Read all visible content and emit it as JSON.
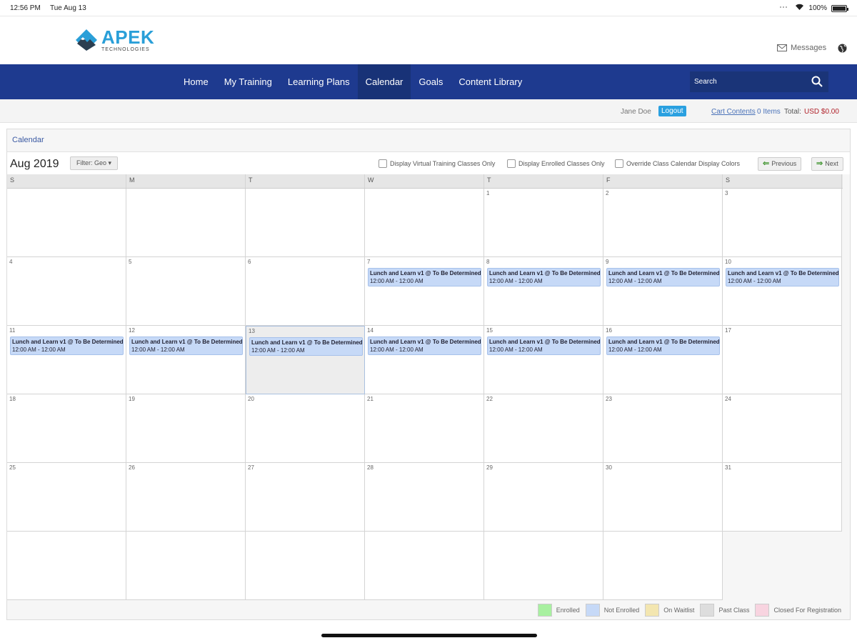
{
  "status_bar": {
    "time": "12:56 PM",
    "date": "Tue Aug 13",
    "battery": "100%",
    "battery_level": 1.0
  },
  "brand": {
    "name": "APEK",
    "subtitle": "TECHNOLOGIES",
    "color": "#2a9fd8"
  },
  "header": {
    "messages_label": "Messages"
  },
  "nav": {
    "items": [
      "Home",
      "My Training",
      "Learning Plans",
      "Calendar",
      "Goals",
      "Content Library"
    ],
    "active": "Calendar",
    "search_placeholder": "Search",
    "bg_color": "#1e3a8f"
  },
  "user": {
    "name": "Jane Doe",
    "logout_label": "Logout",
    "cart_link": "Cart Contents",
    "cart_items": "0 Items",
    "total_label": "Total:",
    "total_value": "USD $0.00"
  },
  "calendar": {
    "panel_title": "Calendar",
    "month_label": "Aug 2019",
    "filter_label": "Filter: Geo",
    "options": [
      "Display Virtual Training Classes Only",
      "Display Enrolled Classes Only",
      "Override Class Calendar Display Colors"
    ],
    "previous_label": "Previous",
    "next_label": "Next",
    "days_of_week": [
      "S",
      "M",
      "T",
      "W",
      "T",
      "F",
      "S"
    ],
    "event_title": "Lunch and Learn v1 @ To Be Determined",
    "event_time": "12:00 AM - 12:00 AM",
    "today": "13",
    "weeks": [
      [
        {
          "day": ""
        },
        {
          "day": ""
        },
        {
          "day": ""
        },
        {
          "day": ""
        },
        {
          "day": "1"
        },
        {
          "day": "2"
        },
        {
          "day": "3"
        }
      ],
      [
        {
          "day": "4"
        },
        {
          "day": "5"
        },
        {
          "day": "6"
        },
        {
          "day": "7",
          "event": true
        },
        {
          "day": "8",
          "event": true
        },
        {
          "day": "9",
          "event": true
        },
        {
          "day": "10",
          "event": true
        }
      ],
      [
        {
          "day": "11",
          "event": true
        },
        {
          "day": "12",
          "event": true
        },
        {
          "day": "13",
          "event": true
        },
        {
          "day": "14",
          "event": true
        },
        {
          "day": "15",
          "event": true
        },
        {
          "day": "16",
          "event": true
        },
        {
          "day": "17"
        }
      ],
      [
        {
          "day": "18"
        },
        {
          "day": "19"
        },
        {
          "day": "20"
        },
        {
          "day": "21"
        },
        {
          "day": "22"
        },
        {
          "day": "23"
        },
        {
          "day": "24"
        }
      ],
      [
        {
          "day": "25"
        },
        {
          "day": "26"
        },
        {
          "day": "27"
        },
        {
          "day": "28"
        },
        {
          "day": "29"
        },
        {
          "day": "30"
        },
        {
          "day": "31"
        }
      ],
      [
        {
          "day": ""
        },
        {
          "day": ""
        },
        {
          "day": ""
        },
        {
          "day": ""
        },
        {
          "day": ""
        },
        {
          "day": ""
        },
        {
          "day": "",
          "blank": true
        }
      ]
    ]
  },
  "legend": [
    {
      "label": "Enrolled",
      "color": "#a8f0a0"
    },
    {
      "label": "Not Enrolled",
      "color": "#c6d9f7"
    },
    {
      "label": "On Waitlist",
      "color": "#f3e6b0"
    },
    {
      "label": "Past Class",
      "color": "#dddddd"
    },
    {
      "label": "Closed For Registration",
      "color": "#f8d4e0"
    }
  ]
}
